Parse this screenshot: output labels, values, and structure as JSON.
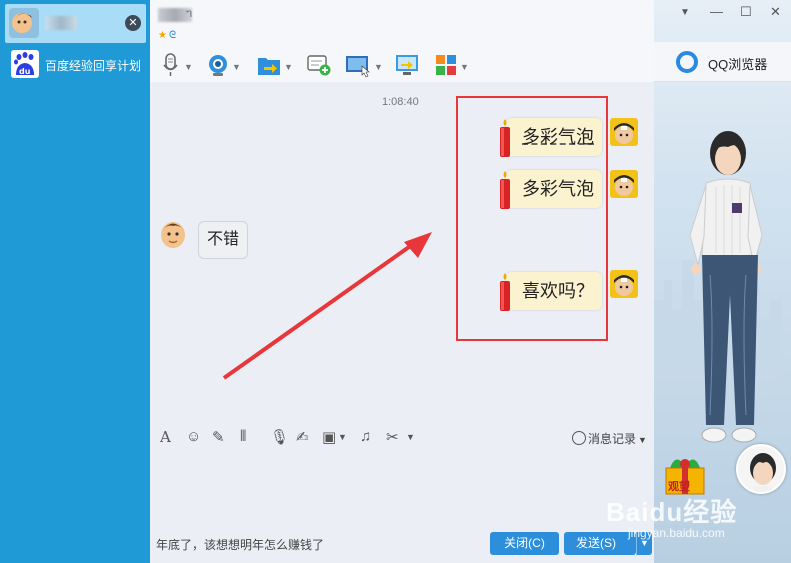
{
  "sidebar": {
    "active_contact": {
      "close_icon": "close-icon"
    },
    "contacts": [
      {
        "name": "百度经验回享计划",
        "icon": "baidu-du-logo"
      }
    ]
  },
  "chat": {
    "status_icons": [
      "star-icon",
      "qzone-icon"
    ],
    "toolbar": [
      "microphone-icon",
      "video-camera-icon",
      "file-transfer-icon",
      "add-message-icon",
      "remote-desktop-icon",
      "screen-share-icon",
      "apps-grid-icon"
    ],
    "timestamp": "1:08:40",
    "messages": [
      {
        "side": "right",
        "text": "多彩气泡"
      },
      {
        "side": "right",
        "text": "多彩气泡"
      },
      {
        "side": "left",
        "text": "不错"
      },
      {
        "side": "right",
        "text": "喜欢吗？"
      }
    ],
    "input_toolbar": [
      "font-icon",
      "emoji-icon",
      "magic-icon",
      "shake-icon",
      "voice-icon",
      "edit-icon",
      "image-icon",
      "music-icon",
      "scissors-icon"
    ],
    "history_label": "消息记录",
    "draft_text": "年底了，该想想明年怎么赚钱了",
    "close_button": "关闭(C)",
    "send_button": "发送(S)"
  },
  "right_pane": {
    "browser_label": "QQ浏览器",
    "gift_label": "观望"
  },
  "watermark": {
    "brand": "Baidu经验",
    "url": "jingyan.baidu.com"
  },
  "colors": {
    "sidebar": "#1f9ad6",
    "accent_button": "#2d8fdb",
    "bubble_out": "#fbf3cf",
    "highlight": "#e8373a"
  }
}
